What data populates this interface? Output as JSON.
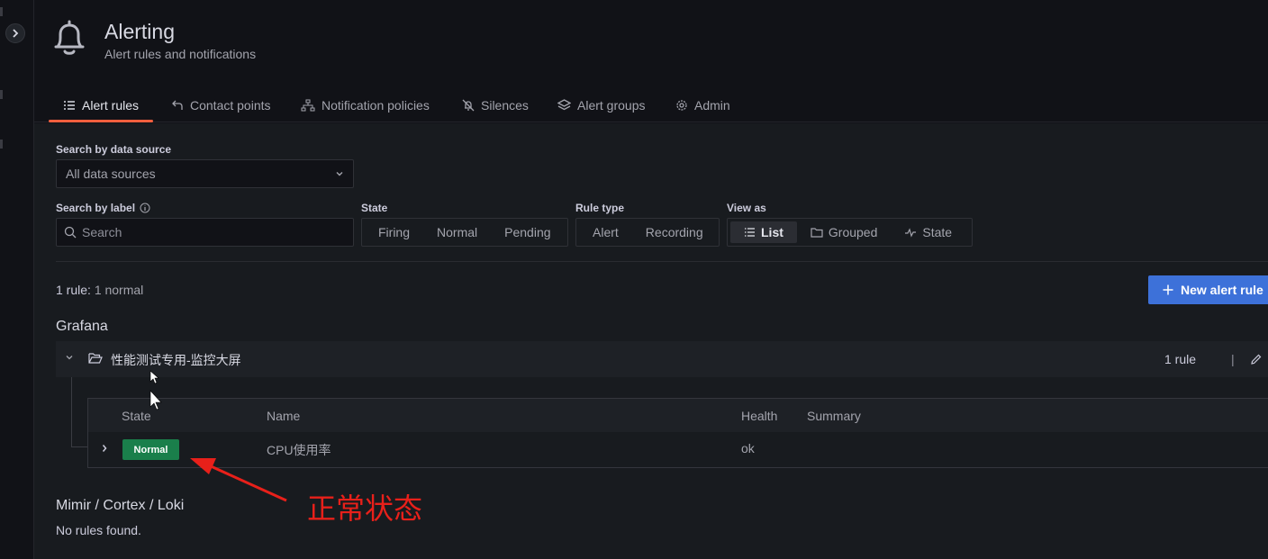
{
  "header": {
    "title": "Alerting",
    "subtitle": "Alert rules and notifications"
  },
  "tabs": [
    {
      "label": "Alert rules",
      "active": true,
      "icon": "list-icon"
    },
    {
      "label": "Contact points",
      "active": false,
      "icon": "comment-alt-share-icon"
    },
    {
      "label": "Notification policies",
      "active": false,
      "icon": "sitemap-icon"
    },
    {
      "label": "Silences",
      "active": false,
      "icon": "bell-slash-icon"
    },
    {
      "label": "Alert groups",
      "active": false,
      "icon": "layer-group-icon"
    },
    {
      "label": "Admin",
      "active": false,
      "icon": "cog-icon"
    }
  ],
  "filters": {
    "datasource_label": "Search by data source",
    "datasource_value": "All data sources",
    "label_search_label": "Search by label",
    "label_search_placeholder": "Search",
    "state_label": "State",
    "state_options": [
      "Firing",
      "Normal",
      "Pending"
    ],
    "rule_type_label": "Rule type",
    "rule_type_options": [
      "Alert",
      "Recording"
    ],
    "view_as_label": "View as",
    "view_as_options": [
      "List",
      "Grouped",
      "State"
    ],
    "view_as_selected": "List"
  },
  "summary": {
    "count": "1 rule:",
    "detail": "1 normal"
  },
  "new_rule_button": "New alert rule",
  "grafana_section": {
    "title": "Grafana",
    "folder": {
      "name": "性能测试专用-监控大屏",
      "rule_count": "1 rule",
      "separator": "|"
    },
    "table": {
      "headers": {
        "state": "State",
        "name": "Name",
        "health": "Health",
        "summary": "Summary"
      },
      "rows": [
        {
          "state": "Normal",
          "name": "CPU使用率",
          "health": "ok",
          "summary": ""
        }
      ]
    }
  },
  "mimir_section": {
    "title": "Mimir / Cortex / Loki",
    "empty_text": "No rules found."
  },
  "annotation": {
    "text": "正常状态",
    "color": "#e8201a"
  },
  "colors": {
    "accent": "#f55f3e",
    "primary_button": "#3d71d9",
    "normal_badge": "#1a7f4b"
  }
}
